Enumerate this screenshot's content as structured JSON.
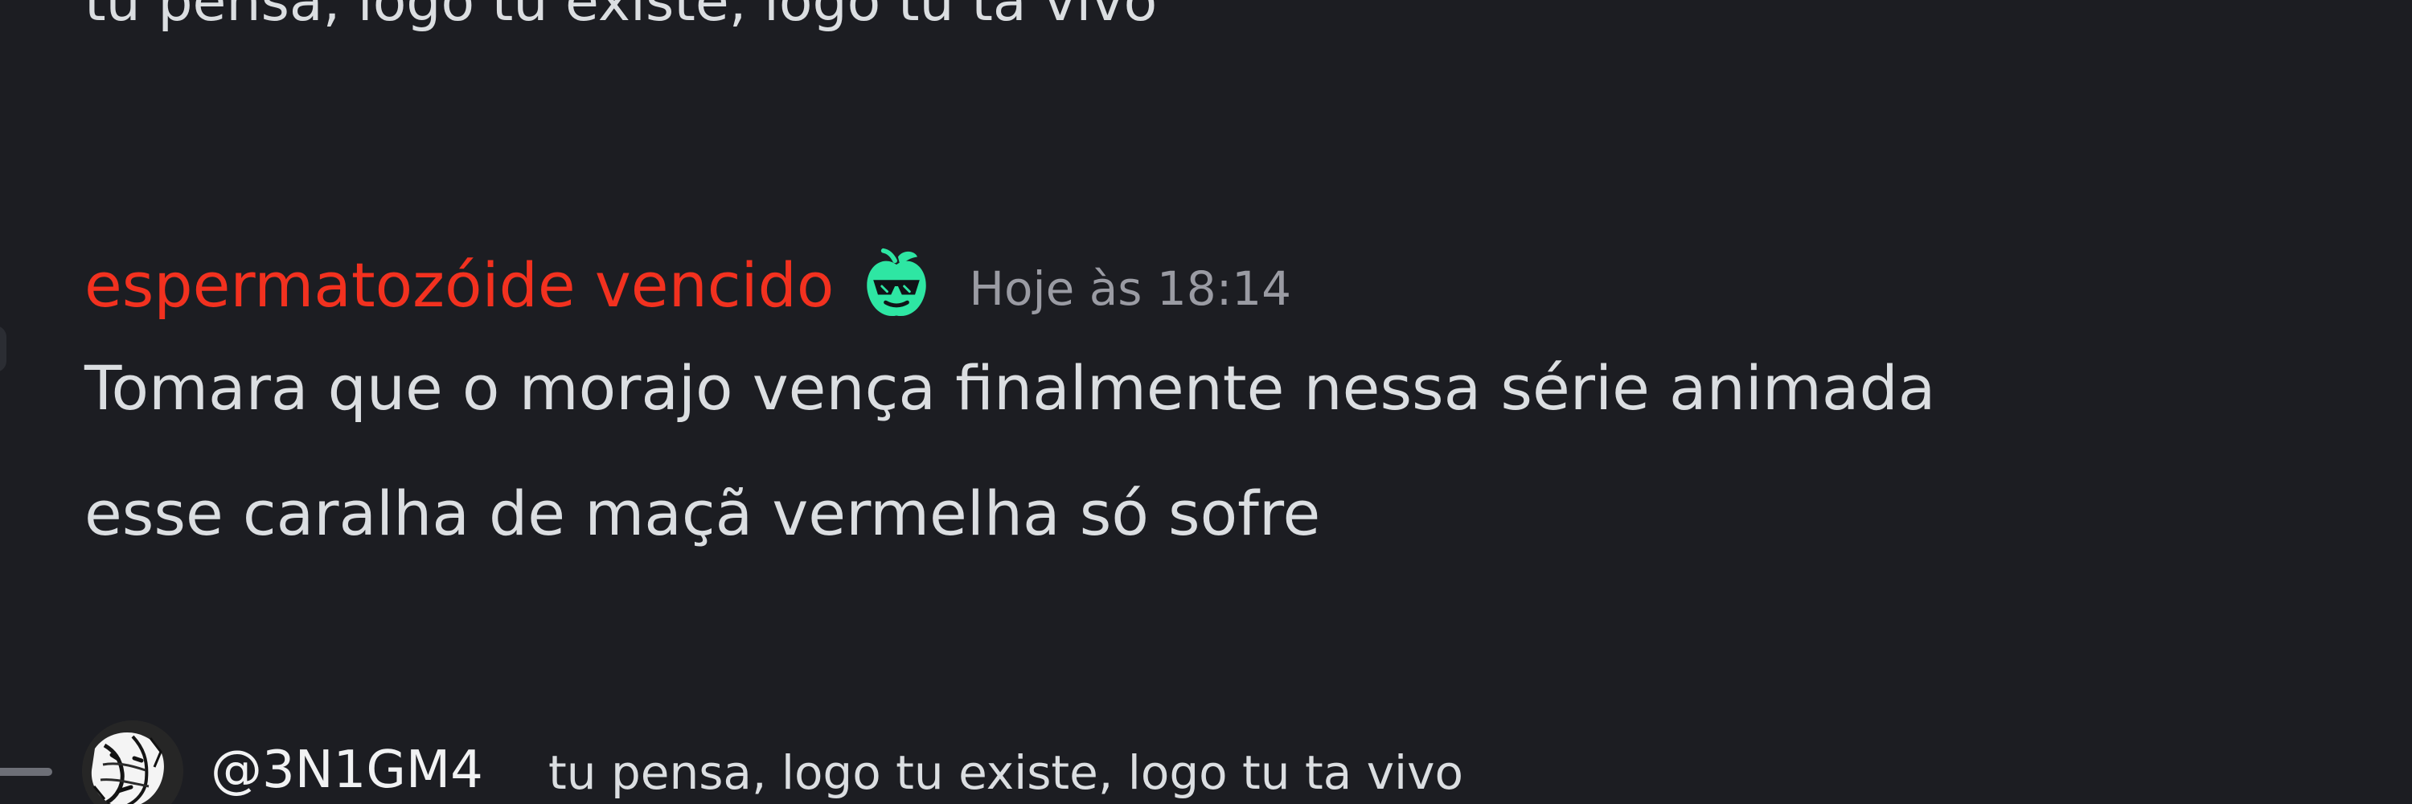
{
  "previous_message": {
    "text": "tu pensa, logo tu existe, logo tu ta vivo"
  },
  "message": {
    "author": "espermatozóide vencido",
    "badge_icon": "green-fruit-sunglasses-icon",
    "timestamp": "Hoje às 18:14",
    "body": "Tomara que o morajo vença finalmente nessa série animada\nesse caralha de maçã vermelha só sofre"
  },
  "reply_preview": {
    "author": "@3N1GM4",
    "text": "tu pensa, logo tu existe, logo tu ta vivo",
    "avatar_icon": "sketched-portrait-avatar"
  },
  "colors": {
    "background": "#1c1d22",
    "username": "#f2311f",
    "message_text": "#dbdee1",
    "timestamp": "#9a9ba3",
    "badge_green": "#2ee6a3"
  }
}
